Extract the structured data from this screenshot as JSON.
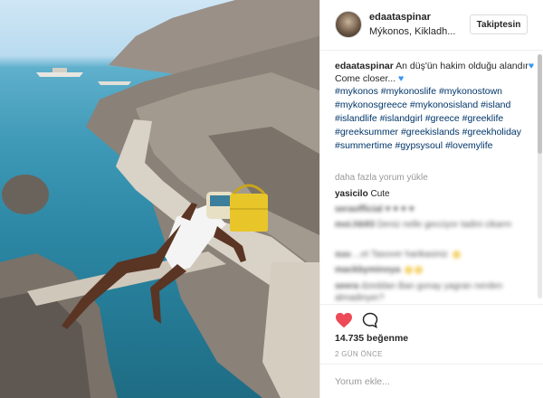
{
  "post": {
    "image_alt": "Woman in white swimsuit sitting on a wooden walkway by the sea",
    "author": {
      "username": "edaataspinar",
      "location": "Mýkonos, Kikladh...",
      "follow_label": "Takiptesin"
    },
    "caption": {
      "username": "edaataspinar",
      "text_line1": "An düş'ün hakim olduğu alandır",
      "text_line2": "Come closer...",
      "hashtags": "#mykonos #mykonoslife #mykonostown #mykonosgreece #mykonosisland #island #islandlife #islandgirl #greece #greeklife #greeksummer #greekislands #greekholiday #summertime #gypsysoul #lovemylife"
    },
    "load_more_label": "daha fazla yorum yükle",
    "comments": [
      {
        "username": "yasicilo",
        "text": "Cute"
      },
      {
        "username": "seraofficial",
        "text": "♥ ♥ ♥ ♥"
      },
      {
        "username": "moi.hb93",
        "text": "Deniz nelle gecciyor tadini cikarm"
      },
      {
        "username": "suu",
        "text": "...et Tasover harikasiniz"
      },
      {
        "username": "mackbyminoya",
        "text": ""
      },
      {
        "username": "seera",
        "text": "dzeddan Ban gonay yagran nerden almadinyer?"
      }
    ],
    "likes_label": "14.735 beğenme",
    "time_label": "2 GÜN ÖNCE",
    "comment_placeholder": "Yorum ekle...",
    "colors": {
      "like_heart": "#ed4956",
      "hashtag": "#003569",
      "muted": "#999999"
    },
    "icons": {
      "like": "heart-filled-icon",
      "comment": "speech-bubble-icon"
    }
  }
}
